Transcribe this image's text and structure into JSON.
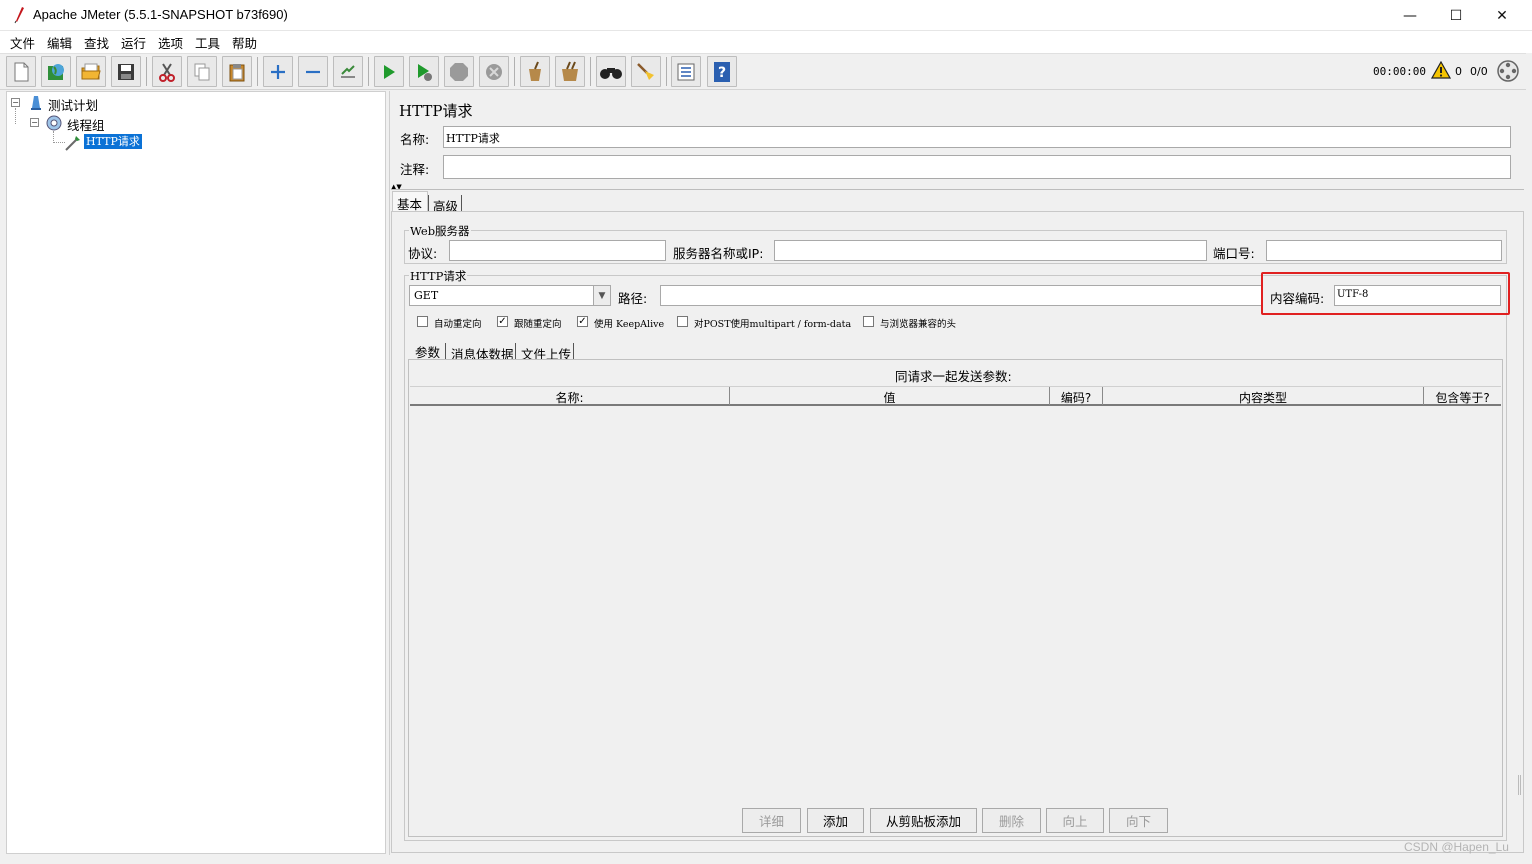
{
  "window": {
    "title": "Apache JMeter (5.5.1-SNAPSHOT b73f690)",
    "minimize_glyph": "—",
    "maximize_glyph": "☐",
    "close_glyph": "✕"
  },
  "menu": [
    "文件",
    "编辑",
    "查找",
    "运行",
    "选项",
    "工具",
    "帮助"
  ],
  "toolbar": {
    "icons": [
      "new-icon",
      "templates-icon",
      "open-icon",
      "save-icon",
      "cut-icon",
      "copy-icon",
      "paste-icon",
      "expand-icon",
      "collapse-icon",
      "toggle-icon",
      "start-icon",
      "start-no-pause-icon",
      "stop-icon",
      "shutdown-icon",
      "clear-icon",
      "clear-all-icon",
      "search-icon",
      "reset-search-icon",
      "function-helper-icon",
      "help-icon"
    ],
    "clock": "00:00:00",
    "warning_count": "0",
    "thread_count": "0/0"
  },
  "tree": {
    "items": [
      {
        "label": "测试计划",
        "icon": "test-plan-icon"
      },
      {
        "label": "线程组",
        "icon": "thread-group-icon"
      },
      {
        "label": "HTTP请求",
        "icon": "sampler-icon",
        "selected": true
      }
    ]
  },
  "panel": {
    "heading": "HTTP请求",
    "name_label": "名称:",
    "name_value": "HTTP请求",
    "comment_label": "注释:",
    "comment_value": "",
    "tabs": [
      "基本",
      "高级"
    ],
    "web_server": {
      "title": "Web服务器",
      "protocol_label": "协议:",
      "protocol_value": "",
      "server_label": "服务器名称或IP:",
      "server_value": "",
      "port_label": "端口号:",
      "port_value": ""
    },
    "http_request": {
      "title": "HTTP请求",
      "method": "GET",
      "path_label": "路径:",
      "path_value": "",
      "encoding_label": "内容编码:",
      "encoding_value": "UTF-8",
      "highlight_color": "#e02020"
    },
    "options": [
      {
        "label": "自动重定向",
        "checked": false
      },
      {
        "label": "跟随重定向",
        "checked": true
      },
      {
        "label": "使用 KeepAlive",
        "checked": true
      },
      {
        "label": "对POST使用multipart / form-data",
        "checked": false
      },
      {
        "label": "与浏览器兼容的头",
        "checked": false
      }
    ],
    "sub_tabs": [
      "参数",
      "消息体数据",
      "文件上传"
    ],
    "params_title": "同请求一起发送参数:",
    "columns": [
      "名称:",
      "值",
      "编码?",
      "内容类型",
      "包含等于?"
    ],
    "buttons": [
      {
        "label": "详细",
        "enabled": false
      },
      {
        "label": "添加",
        "enabled": true
      },
      {
        "label": "从剪贴板添加",
        "enabled": true
      },
      {
        "label": "删除",
        "enabled": false
      },
      {
        "label": "向上",
        "enabled": false
      },
      {
        "label": "向下",
        "enabled": false
      }
    ]
  },
  "watermark": "CSDN @Hapen_Lu"
}
